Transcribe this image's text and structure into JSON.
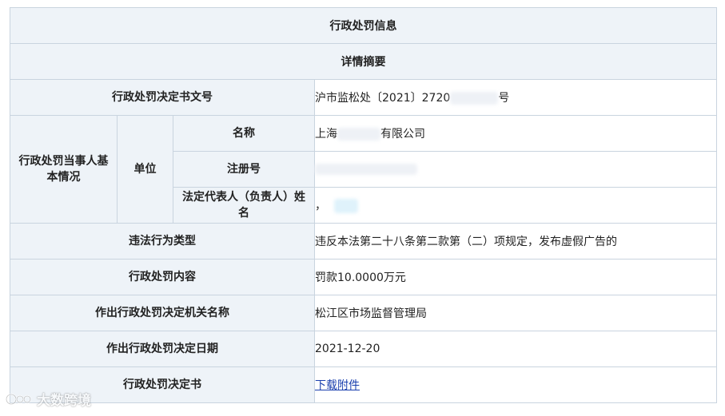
{
  "title": "行政处罚信息",
  "subtitle": "详情摘要",
  "rows": {
    "doc_no": {
      "label": "行政处罚决定书文号",
      "value_prefix": "沪市监松处〔2021〕2720",
      "value_suffix": "号"
    },
    "party": {
      "group_label": "行政处罚当事人基本情况",
      "unit_label": "单位",
      "name": {
        "label": "名称",
        "value_prefix": "上海",
        "value_suffix": "有限公司"
      },
      "reg_no": {
        "label": "注册号"
      },
      "legal_rep": {
        "label": "法定代表人（负责人）姓名",
        "value_prefix": "，"
      }
    },
    "violation_type": {
      "label": "违法行为类型",
      "value": "违反本法第二十八条第二款第（二）项规定，发布虚假广告的"
    },
    "penalty": {
      "label": "行政处罚内容",
      "value": "罚款10.0000万元"
    },
    "authority": {
      "label": "作出行政处罚决定机关名称",
      "value": "松江区市场监督管理局"
    },
    "date": {
      "label": "作出行政处罚决定日期",
      "value": "2021-12-20"
    },
    "document": {
      "label": "行政处罚决定书",
      "link": "下载附件"
    }
  },
  "watermark": {
    "text": "大数跨境",
    "icon": "watermark-logo-icon"
  },
  "colors": {
    "label_bg": "#eef3f8",
    "border": "#c9d4df",
    "link": "#1a3fae"
  }
}
